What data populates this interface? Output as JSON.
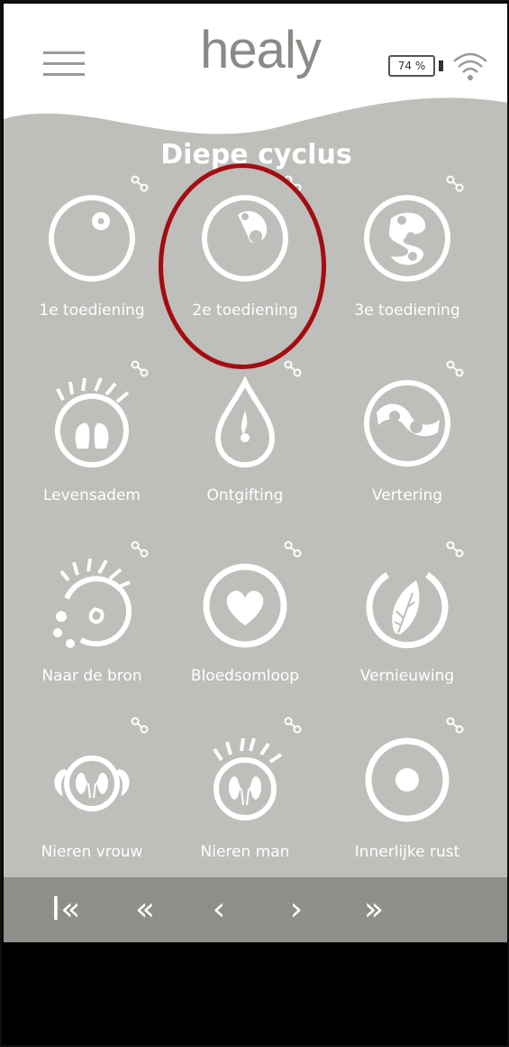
{
  "header": {
    "logo": "healy",
    "battery": "74 %"
  },
  "section_title": "Diepe cyclus",
  "tiles": [
    {
      "label": "1e toediening",
      "icon": "single-dot-circle-icon"
    },
    {
      "label": "2e toediening",
      "icon": "two-dots-circle-icon"
    },
    {
      "label": "3e toediening",
      "icon": "three-dots-circle-icon"
    },
    {
      "label": "Levensadem",
      "icon": "lungs-icon"
    },
    {
      "label": "Ontgifting",
      "icon": "droplet-icon"
    },
    {
      "label": "Vertering",
      "icon": "digestion-icon"
    },
    {
      "label": "Naar de bron",
      "icon": "source-icon"
    },
    {
      "label": "Bloedsomloop",
      "icon": "heart-circle-icon"
    },
    {
      "label": "Vernieuwing",
      "icon": "leaf-icon"
    },
    {
      "label": "Nieren vrouw",
      "icon": "kidneys-female-icon"
    },
    {
      "label": "Nieren man",
      "icon": "kidneys-male-icon"
    },
    {
      "label": "Innerlijke rust",
      "icon": "dot-circle-icon"
    }
  ],
  "nav": {
    "first": "I«",
    "prev_page": "«",
    "prev": "‹",
    "next": "›",
    "next_page": "»"
  },
  "colors": {
    "background": "#bebebb",
    "header": "#ffffff",
    "navbar": "#8e8e8a",
    "highlight": "#a40d10"
  }
}
